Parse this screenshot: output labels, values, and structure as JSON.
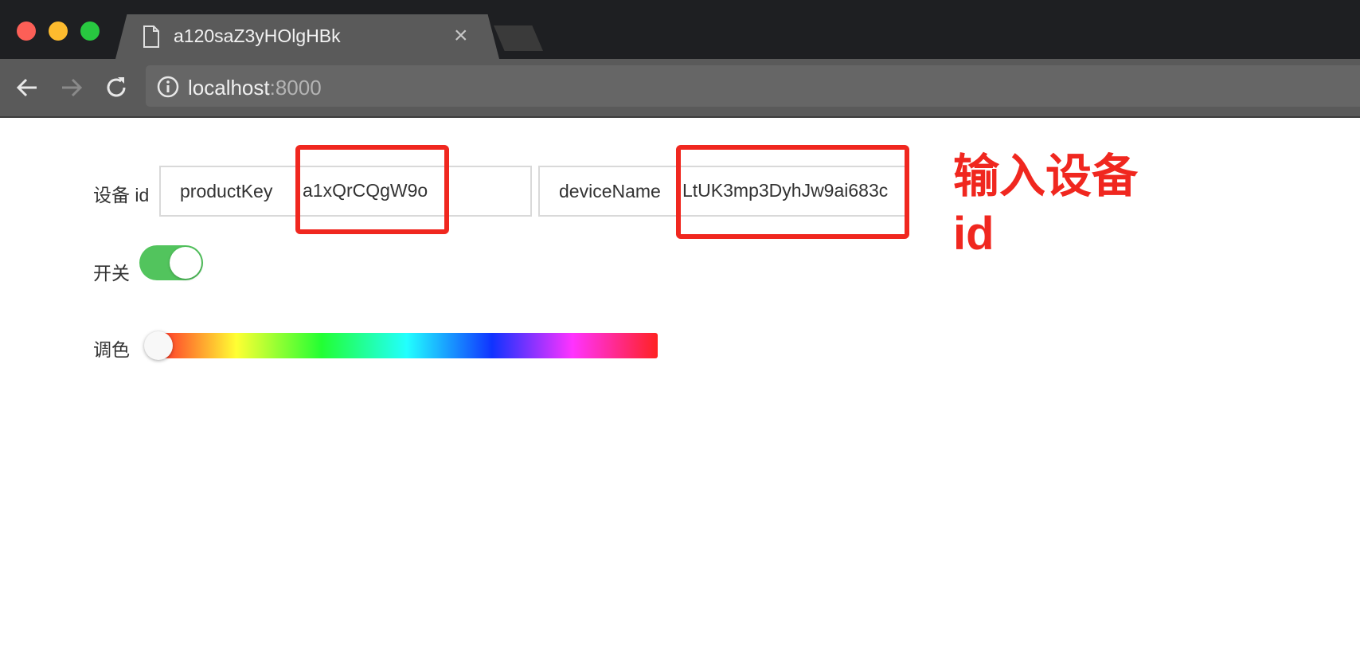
{
  "browser": {
    "tab_title": "a120saZ3yHOlgHBk",
    "tab_close": "×",
    "url_host": "localhost",
    "url_port": ":8000"
  },
  "form": {
    "device_id_label": "设备 id",
    "product_key_label": "productKey",
    "product_key_value": "a1xQrCQgW9o",
    "device_name_label": "deviceName",
    "device_name_value": "LtUK3mp3DyhJw9ai683c",
    "switch_label": "开关",
    "switch_on": true,
    "color_label": "调色",
    "hue_value": 0
  },
  "annotation": {
    "text": "输入设备id",
    "color": "#f0271f"
  },
  "colors": {
    "toggle_on": "#52c45d",
    "highlight": "#f0271f"
  }
}
